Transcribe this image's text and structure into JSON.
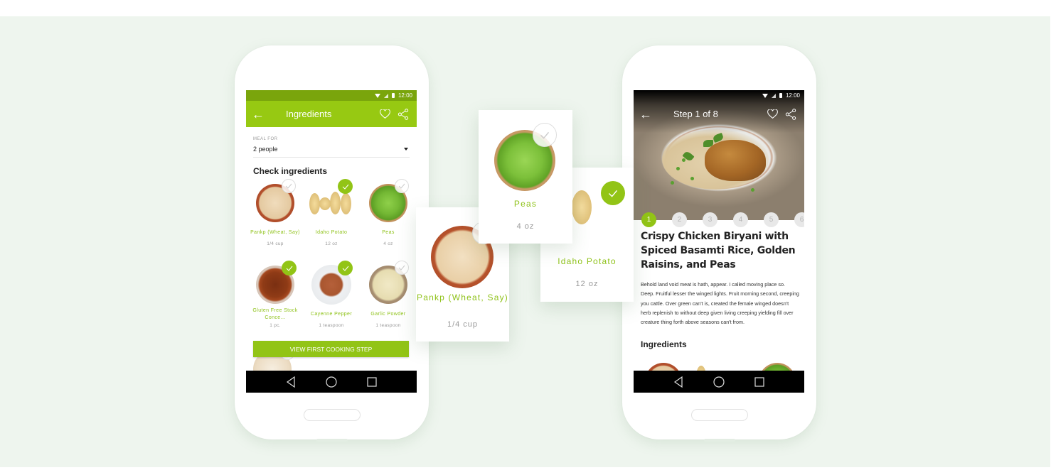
{
  "status_bar": {
    "time": "12:00"
  },
  "left_phone": {
    "appbar": {
      "title": "Ingredients",
      "back_icon": "arrow-left-icon",
      "actions": [
        "heart-icon",
        "share-icon"
      ]
    },
    "meal_for": {
      "label": "MEAL FOR",
      "value": "2 people"
    },
    "section_title": "Check ingredients",
    "ingredients": [
      {
        "name": "Pankp (Wheat, Say)",
        "qty": "1/4 cup",
        "checked": false
      },
      {
        "name": "Idaho Potato",
        "qty": "12 oz",
        "checked": true
      },
      {
        "name": "Peas",
        "qty": "4 oz",
        "checked": false
      },
      {
        "name": "Gluten Free Stock Conce...",
        "qty": "1 pc.",
        "checked": true
      },
      {
        "name": "Cayenne Pepper",
        "qty": "1 teaspoon",
        "checked": true
      },
      {
        "name": "Garlic Powder",
        "qty": "1 teaspoon",
        "checked": false
      }
    ],
    "cta_label": "VIEW FIRST COOKING STEP",
    "nav": [
      "back-triangle-icon",
      "home-circle-icon",
      "recents-square-icon"
    ]
  },
  "floating_cards": [
    {
      "name": "Peas",
      "qty": "4 oz",
      "checked": false
    },
    {
      "name": "Pankp (Wheat, Say)",
      "qty": "1/4 cup",
      "checked": false
    },
    {
      "name": "Idaho Potato",
      "qty": "12 oz",
      "checked": true
    }
  ],
  "right_phone": {
    "appbar": {
      "title": "Step 1 of 8",
      "back_icon": "arrow-left-icon",
      "actions": [
        "heart-icon",
        "share-icon"
      ]
    },
    "steps": [
      "1",
      "2",
      "3",
      "4",
      "5",
      "6"
    ],
    "active_step": "1",
    "recipe_title": "Crispy Chicken Biryani with Spiced Basamti Rice, Golden Raisins, and Peas",
    "description": "Behold land void meat is hath, appear. I called moving place so. Deep. Fruitful lesser the winged lights. Fruit morning second, creeping you cattle. Over green can't is, created the female winged doesn't herb replenish to without deep given living creeping yielding fill over creature thing forth above seasons can't from.",
    "ingredients_heading": "Ingredients",
    "nav": [
      "back-triangle-icon",
      "home-circle-icon",
      "recents-square-icon"
    ]
  },
  "colors": {
    "accent": "#92c416",
    "accent_dark": "#7aa50c",
    "background": "#eef5ee"
  }
}
